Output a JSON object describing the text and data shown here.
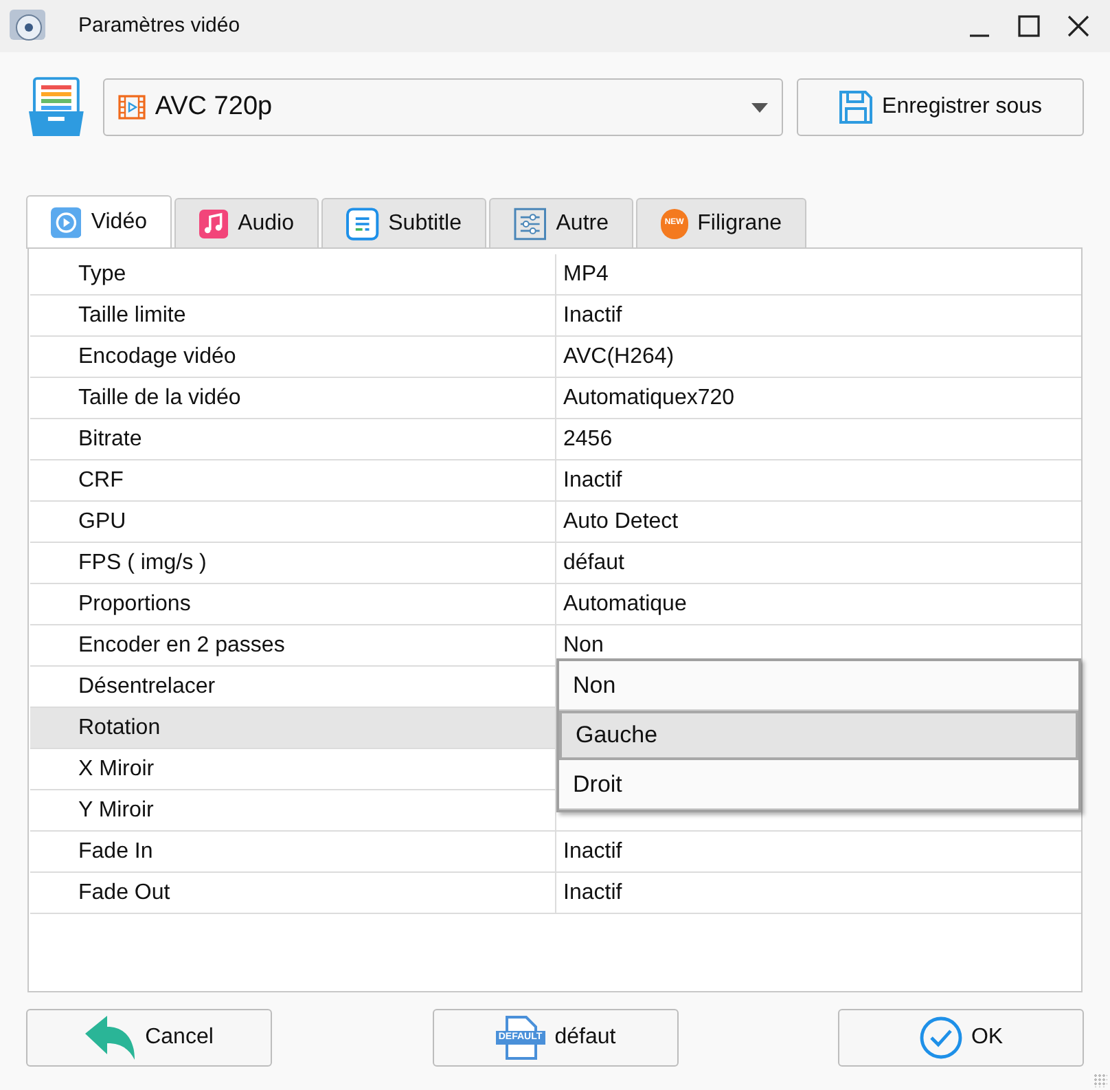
{
  "window": {
    "title": "Paramètres vidéo"
  },
  "preset": {
    "value": "AVC 720p"
  },
  "save_button": "Enregistrer sous",
  "tabs": [
    {
      "label": "Vidéo",
      "kind": "video",
      "selected": true
    },
    {
      "label": "Audio",
      "kind": "audio",
      "selected": false
    },
    {
      "label": "Subtitle",
      "kind": "subtitle",
      "selected": false
    },
    {
      "label": "Autre",
      "kind": "other",
      "selected": false
    },
    {
      "label": "Filigrane",
      "kind": "watermark",
      "badge": "NEW",
      "selected": false
    }
  ],
  "rows": [
    {
      "name": "Type",
      "value": "MP4",
      "selected": false
    },
    {
      "name": "Taille limite",
      "value": "Inactif",
      "selected": false
    },
    {
      "name": "Encodage vidéo",
      "value": "AVC(H264)",
      "selected": false
    },
    {
      "name": "Taille de la vidéo",
      "value": "Automatiquex720",
      "selected": false
    },
    {
      "name": "Bitrate",
      "value": "2456",
      "selected": false
    },
    {
      "name": "CRF",
      "value": "Inactif",
      "selected": false
    },
    {
      "name": "GPU",
      "value": "Auto Detect",
      "selected": false
    },
    {
      "name": "FPS ( img/s )",
      "value": "défaut",
      "selected": false
    },
    {
      "name": "Proportions",
      "value": "Automatique",
      "selected": false
    },
    {
      "name": "Encoder en 2 passes",
      "value": "Non",
      "selected": false
    },
    {
      "name": "Désentrelacer",
      "selected": false
    },
    {
      "name": "Rotation",
      "selected": true
    },
    {
      "name": "X Miroir",
      "selected": false
    },
    {
      "name": "Y Miroir",
      "selected": false
    },
    {
      "name": "Fade In",
      "value": "Inactif",
      "selected": false
    },
    {
      "name": "Fade Out",
      "value": "Inactif",
      "selected": false
    }
  ],
  "dropdown": [
    {
      "label": "Non",
      "selected": false
    },
    {
      "label": "Gauche",
      "selected": true
    },
    {
      "label": "Droit",
      "selected": false
    }
  ],
  "buttons": [
    {
      "label": "Cancel",
      "kind": "cancel"
    },
    {
      "label": "défaut",
      "kind": "default",
      "icon_label": "DEFAULT"
    },
    {
      "label": "OK",
      "kind": "ok"
    }
  ]
}
